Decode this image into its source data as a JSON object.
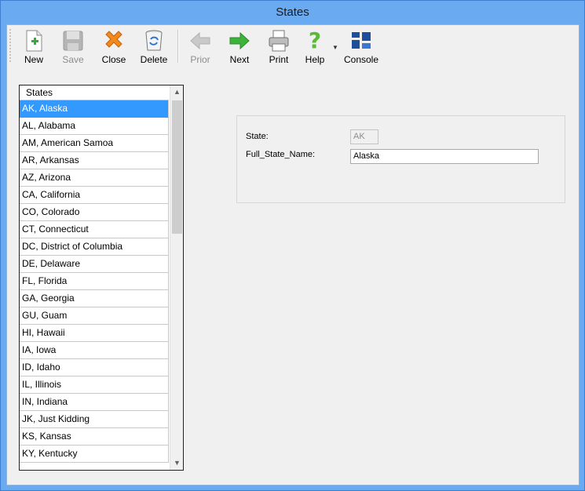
{
  "window": {
    "title": "States"
  },
  "toolbar": {
    "new": "New",
    "save": "Save",
    "close": "Close",
    "delete": "Delete",
    "prior": "Prior",
    "next": "Next",
    "print": "Print",
    "help": "Help",
    "console": "Console"
  },
  "list": {
    "header": "States",
    "selected_index": 0,
    "items": [
      "AK, Alaska",
      "AL, Alabama",
      "AM, American Samoa",
      "AR, Arkansas",
      "AZ, Arizona",
      "CA, California",
      "CO, Colorado",
      "CT, Connecticut",
      "DC, District of Columbia",
      "DE, Delaware",
      "FL, Florida",
      "GA, Georgia",
      "GU, Guam",
      "HI, Hawaii",
      "IA, Iowa",
      "ID, Idaho",
      "IL, Illinois",
      "IN, Indiana",
      "JK, Just Kidding",
      "KS, Kansas",
      "KY, Kentucky"
    ]
  },
  "form": {
    "state_label": "State:",
    "state_value": "AK",
    "full_name_label": "Full_State_Name:",
    "full_name_value": "Alaska"
  },
  "colors": {
    "selection": "#3399ff",
    "window_frame": "#6aaaf0"
  }
}
